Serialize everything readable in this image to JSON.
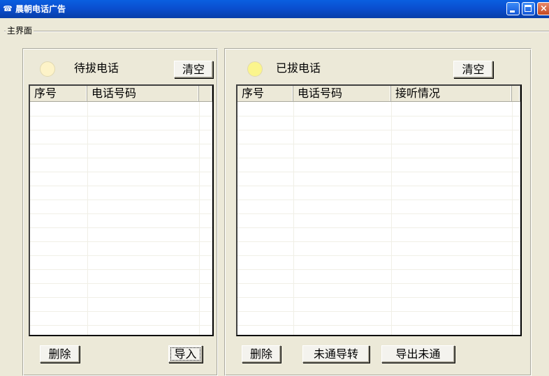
{
  "window": {
    "title": "晨朝电话广告",
    "icon": "app-icon",
    "controls": {
      "minimize": "minimize-icon",
      "maximize": "maximize-icon",
      "close": "×"
    }
  },
  "group": {
    "label": "主界面"
  },
  "pending": {
    "title": "待拔电话",
    "led_color": "#fdf3c8",
    "clear_label": "清空",
    "columns": [
      "序号",
      "电话号码",
      ""
    ],
    "rows": [],
    "delete_label": "删除",
    "import_label": "导入"
  },
  "dialed": {
    "title": "已拔电话",
    "led_color": "#fbf58c",
    "clear_label": "清空",
    "columns": [
      "序号",
      "电话号码",
      "接听情况",
      ""
    ],
    "rows": [],
    "delete_label": "删除",
    "forward_label": "未通导转",
    "export_label": "导出未通"
  }
}
